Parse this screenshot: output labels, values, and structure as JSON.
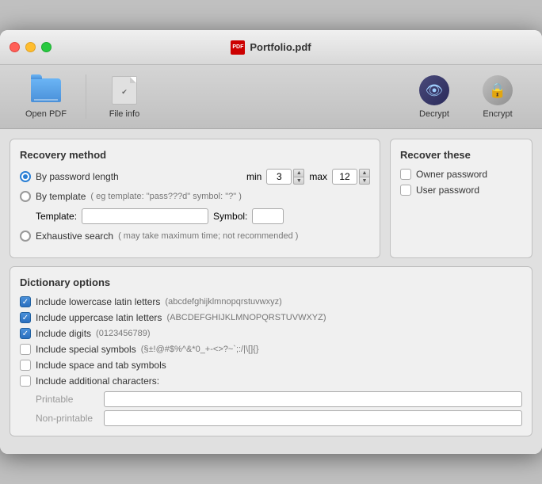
{
  "window": {
    "title": "Portfolio.pdf",
    "controls": {
      "close_label": "",
      "minimize_label": "",
      "maximize_label": ""
    }
  },
  "toolbar": {
    "items": [
      {
        "id": "open-pdf",
        "label": "Open PDF",
        "icon": "folder"
      },
      {
        "id": "file-info",
        "label": "File info",
        "icon": "doc"
      },
      {
        "id": "decrypt",
        "label": "Decrypt",
        "icon": "decrypt"
      },
      {
        "id": "encrypt",
        "label": "Encrypt",
        "icon": "lock"
      }
    ]
  },
  "recovery": {
    "header": "Recovery method",
    "options": [
      {
        "id": "by-length",
        "label": "By password length",
        "checked": true
      },
      {
        "id": "by-template",
        "label": "By template",
        "checked": false,
        "hint": "( eg template: \"pass???d\" symbol: \"?\" )"
      },
      {
        "id": "exhaustive",
        "label": "Exhaustive search",
        "checked": false,
        "hint": "( may take maximum time; not recommended )"
      }
    ],
    "min_label": "min",
    "max_label": "max",
    "min_value": "3",
    "max_value": "12",
    "template_label": "Template:",
    "symbol_label": "Symbol:"
  },
  "recover_these": {
    "header": "Recover these",
    "options": [
      {
        "id": "owner-password",
        "label": "Owner password",
        "checked": false
      },
      {
        "id": "user-password",
        "label": "User password",
        "checked": false
      }
    ]
  },
  "dictionary": {
    "header": "Dictionary options",
    "options": [
      {
        "id": "lowercase",
        "label": "Include lowercase latin letters",
        "hint": "(abcdefghijklmnopqrstuvwxyz)",
        "checked": true
      },
      {
        "id": "uppercase",
        "label": "Include uppercase latin letters",
        "hint": "(ABCDEFGHIJKLMNOPQRSTUVWXYZ)",
        "checked": true
      },
      {
        "id": "digits",
        "label": "Include digits",
        "hint": "(0123456789)",
        "checked": true
      },
      {
        "id": "special",
        "label": "Include special symbols",
        "hint": "(§±!@#$%^&*0_+-<>?~`;:/|\\[]{}",
        "checked": false
      },
      {
        "id": "space-tab",
        "label": "Include space and tab symbols",
        "hint": "",
        "checked": false
      },
      {
        "id": "additional",
        "label": "Include additional characters:",
        "hint": "",
        "checked": false
      }
    ],
    "printable_label": "Printable",
    "non_printable_label": "Non-printable"
  }
}
